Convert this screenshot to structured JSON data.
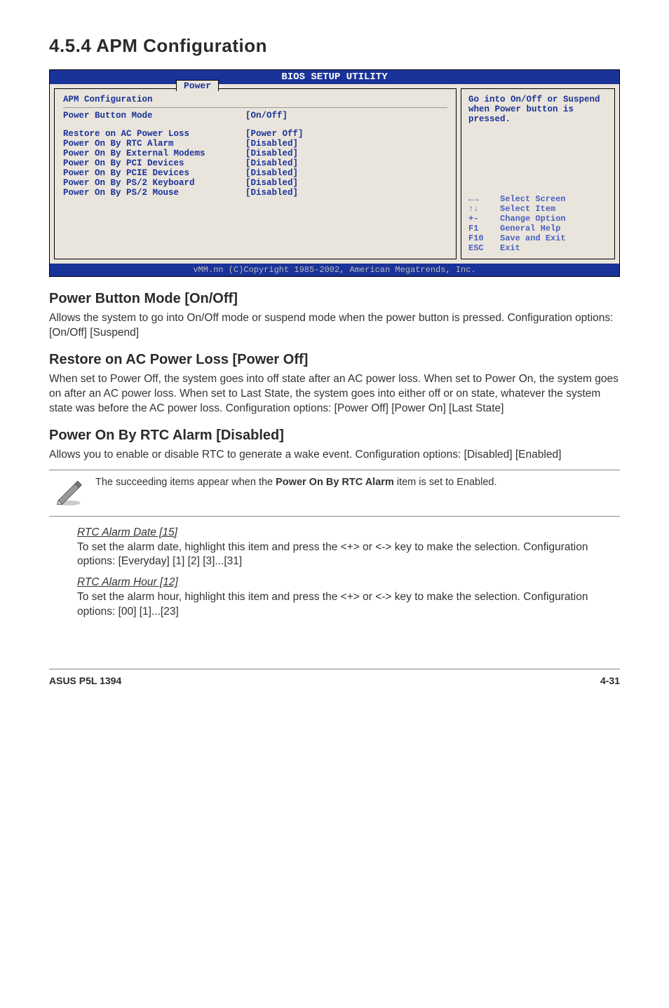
{
  "section_title": "4.5.4   APM Configuration",
  "bios": {
    "header": "BIOS SETUP UTILITY",
    "tab": "Power",
    "config_title": "APM Configuration",
    "rows": [
      {
        "label": "Power Button Mode",
        "value": "[On/Off]"
      },
      {
        "label": "Restore on AC Power Loss",
        "value": "[Power Off]"
      },
      {
        "label": "Power On By RTC Alarm",
        "value": "[Disabled]"
      },
      {
        "label": "Power On By External Modems",
        "value": "[Disabled]"
      },
      {
        "label": "Power On By PCI Devices",
        "value": "[Disabled]"
      },
      {
        "label": "Power On By PCIE Devices",
        "value": "[Disabled]"
      },
      {
        "label": "Power On By PS/2 Keyboard",
        "value": "[Disabled]"
      },
      {
        "label": "Power On By PS/2 Mouse",
        "value": "[Disabled]"
      }
    ],
    "hint": "Go into On/Off or Suspend when Power button is pressed.",
    "nav": [
      {
        "key": "←→",
        "action": "Select Screen"
      },
      {
        "key": "↑↓",
        "action": "Select Item"
      },
      {
        "key": "+-",
        "action": "Change Option"
      },
      {
        "key": "F1",
        "action": "General Help"
      },
      {
        "key": "F10",
        "action": "Save and Exit"
      },
      {
        "key": "ESC",
        "action": "Exit"
      }
    ],
    "footer": "vMM.nn (C)Copyright 1985-2002, American Megatrends, Inc."
  },
  "sections": {
    "s1": {
      "title": "Power Button Mode [On/Off]",
      "text": "Allows the system to go into On/Off mode or suspend mode when the power button is pressed. Configuration options: [On/Off] [Suspend]"
    },
    "s2": {
      "title": "Restore on AC Power Loss [Power Off]",
      "text": "When set to Power Off, the system goes into off state after an AC power loss. When set to Power On, the system goes on after an AC power loss. When set to Last State, the system goes into either off or on state, whatever the system state was before the AC power loss. Configuration options: [Power Off] [Power On] [Last State]"
    },
    "s3": {
      "title": "Power On By RTC Alarm [Disabled]",
      "text": "Allows you to enable or disable RTC to generate a wake event. Configuration options: [Disabled] [Enabled]"
    }
  },
  "note": {
    "prefix": "The succeeding items appear when the ",
    "bold": "Power On By RTC Alarm",
    "suffix": " item is set to Enabled."
  },
  "subitems": {
    "i1": {
      "title": "RTC Alarm Date [15]",
      "text": "To set the alarm date, highlight this item and press the <+> or <-> key to make the selection. Configuration options: [Everyday] [1] [2] [3]...[31]"
    },
    "i2": {
      "title": "RTC Alarm Hour [12]",
      "text": "To set the alarm hour, highlight this item and press the <+> or <-> key to make the selection. Configuration options: [00] [1]...[23]"
    }
  },
  "footer": {
    "left": "ASUS P5L 1394",
    "right": "4-31"
  }
}
